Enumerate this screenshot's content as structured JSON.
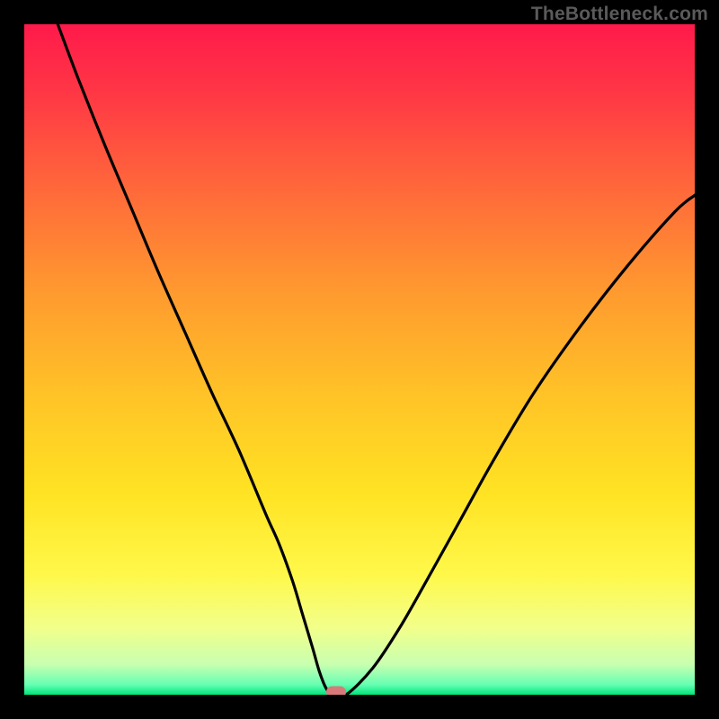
{
  "watermark": "TheBottleneck.com",
  "chart_data": {
    "type": "line",
    "title": "",
    "xlabel": "",
    "ylabel": "",
    "xlim": [
      0,
      100
    ],
    "ylim": [
      0,
      100
    ],
    "gradient_stops": [
      {
        "pos": 0.0,
        "color": "#ff1a4b"
      },
      {
        "pos": 0.1,
        "color": "#ff3645"
      },
      {
        "pos": 0.25,
        "color": "#ff6a3a"
      },
      {
        "pos": 0.4,
        "color": "#ff9a2f"
      },
      {
        "pos": 0.55,
        "color": "#ffc227"
      },
      {
        "pos": 0.7,
        "color": "#ffe323"
      },
      {
        "pos": 0.82,
        "color": "#fff84a"
      },
      {
        "pos": 0.9,
        "color": "#f2ff8a"
      },
      {
        "pos": 0.955,
        "color": "#c8ffb0"
      },
      {
        "pos": 0.985,
        "color": "#66ffb3"
      },
      {
        "pos": 1.0,
        "color": "#00e57a"
      }
    ],
    "series": [
      {
        "name": "bottleneck-curve",
        "color": "#000000",
        "x": [
          5,
          8,
          12,
          16,
          20,
          24,
          28,
          32,
          36,
          38,
          40,
          41.5,
          43,
          44,
          45,
          46,
          48,
          52,
          56,
          60,
          65,
          70,
          76,
          83,
          90,
          97,
          100
        ],
        "y": [
          100,
          92,
          82,
          72.5,
          63,
          54,
          45,
          36.5,
          27,
          22.5,
          17,
          12,
          7,
          3.5,
          1,
          0,
          0,
          4,
          10,
          17,
          26,
          35,
          45,
          55,
          64,
          72,
          74.5
        ]
      }
    ],
    "marker": {
      "x": 46.5,
      "y": 0.4,
      "color": "#d97a7a"
    }
  }
}
